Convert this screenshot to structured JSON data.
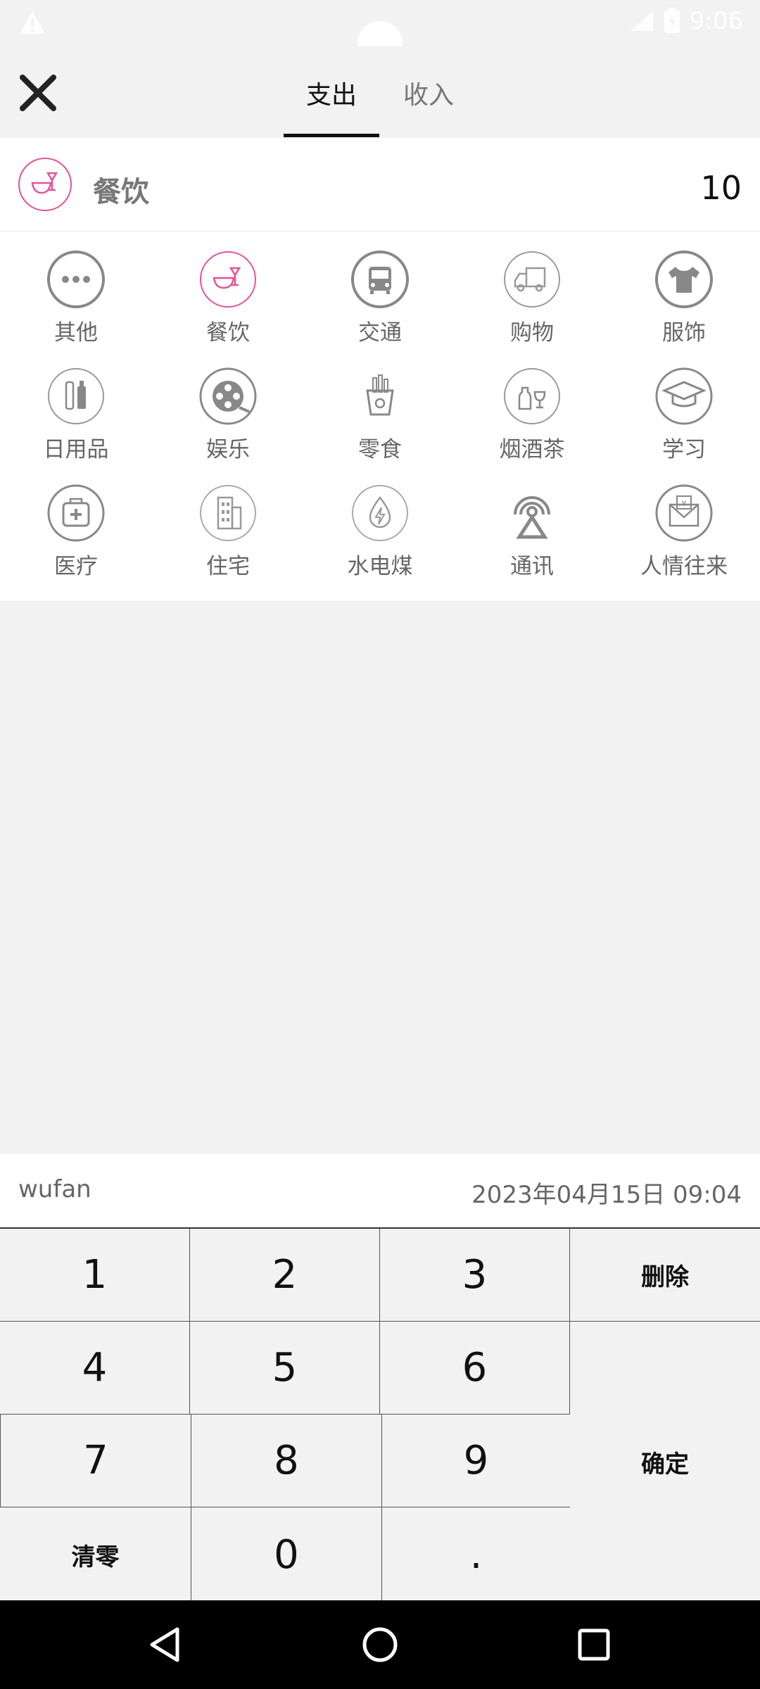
{
  "status": {
    "time": "9:06"
  },
  "header": {
    "tabs": [
      {
        "label": "支出",
        "active": true
      },
      {
        "label": "收入",
        "active": false
      }
    ]
  },
  "selected": {
    "label": "餐饮",
    "amount": "10"
  },
  "categories": [
    {
      "label": "其他",
      "icon": "more-icon"
    },
    {
      "label": "餐饮",
      "icon": "dining-icon"
    },
    {
      "label": "交通",
      "icon": "bus-icon"
    },
    {
      "label": "购物",
      "icon": "truck-icon"
    },
    {
      "label": "服饰",
      "icon": "shirt-icon"
    },
    {
      "label": "日用品",
      "icon": "toiletries-icon"
    },
    {
      "label": "娱乐",
      "icon": "film-reel-icon"
    },
    {
      "label": "零食",
      "icon": "snack-icon"
    },
    {
      "label": "烟酒茶",
      "icon": "wine-icon"
    },
    {
      "label": "学习",
      "icon": "graduation-cap-icon"
    },
    {
      "label": "医疗",
      "icon": "medical-kit-icon"
    },
    {
      "label": "住宅",
      "icon": "building-icon"
    },
    {
      "label": "水电煤",
      "icon": "utilities-icon"
    },
    {
      "label": "通讯",
      "icon": "antenna-icon"
    },
    {
      "label": "人情往来",
      "icon": "envelope-icon"
    }
  ],
  "note": {
    "text": "wufan",
    "date": "2023年04月15日 09:04"
  },
  "keypad": {
    "k1": "1",
    "k2": "2",
    "k3": "3",
    "delete": "删除",
    "k4": "4",
    "k5": "5",
    "k6": "6",
    "k7": "7",
    "k8": "8",
    "k9": "9",
    "confirm": "确定",
    "clear": "清零",
    "k0": "0",
    "dot": "."
  },
  "colors": {
    "accent": "#e5529a",
    "icon_gray": "#888888"
  }
}
